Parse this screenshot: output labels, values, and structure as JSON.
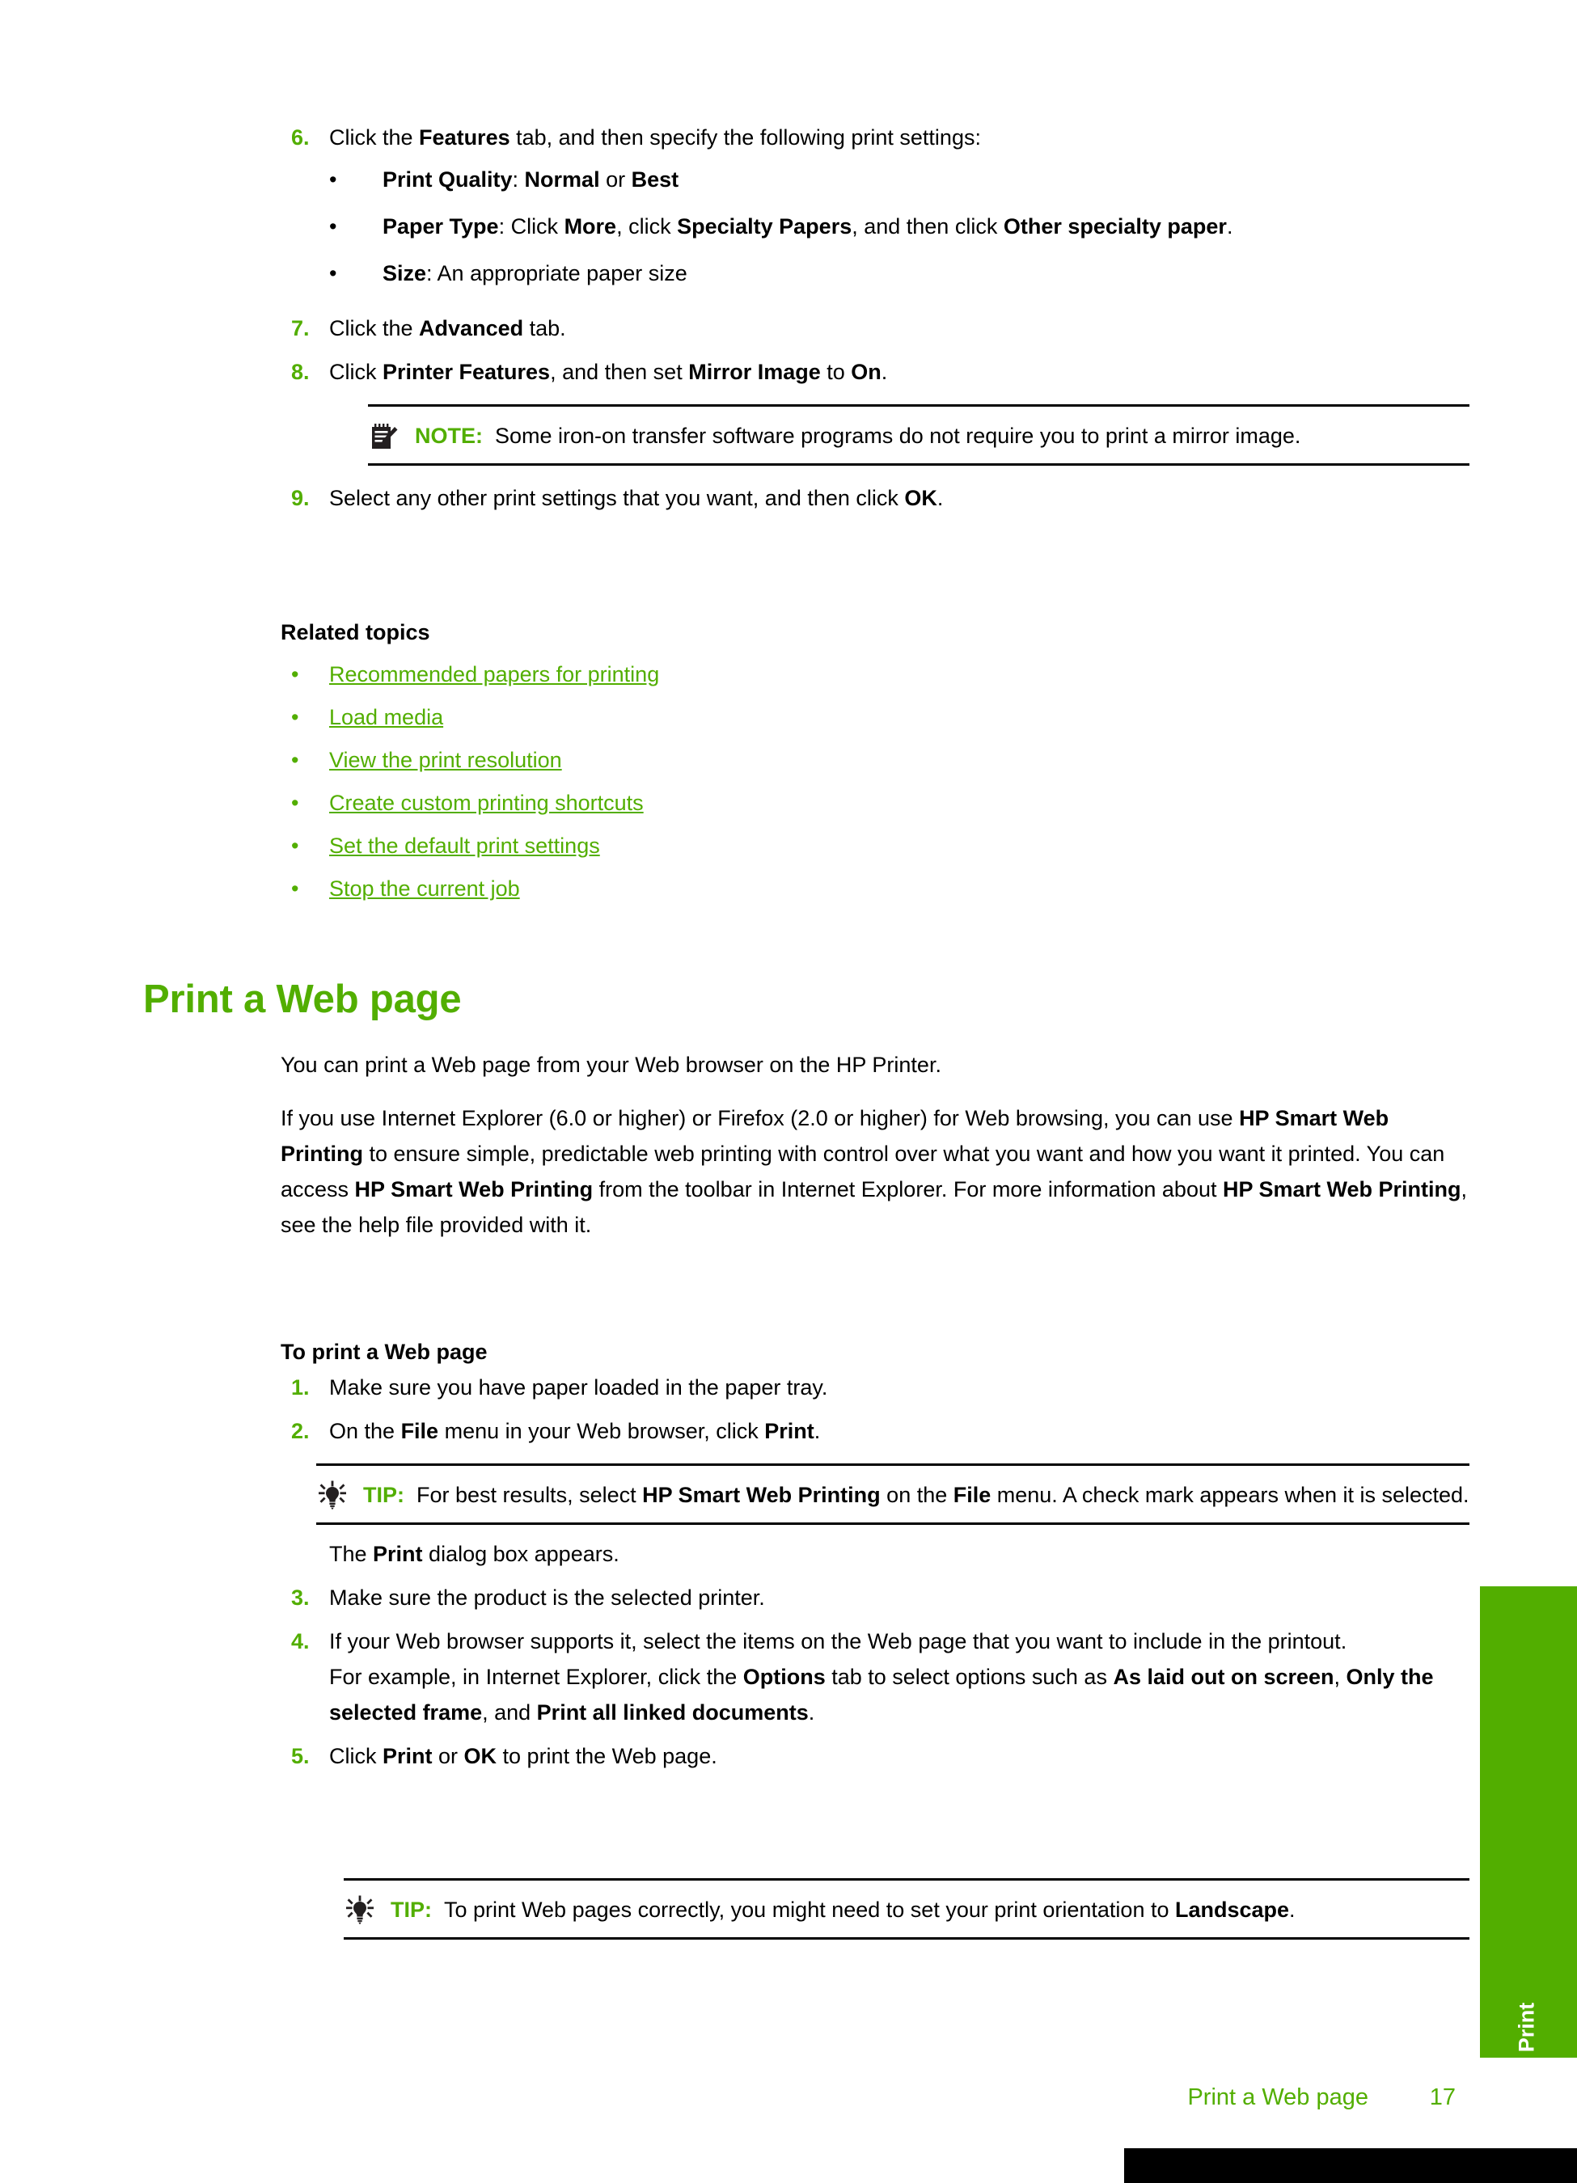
{
  "colors": {
    "accent_green": "#52ae00",
    "text_black": "#000000",
    "page_white": "#ffffff"
  },
  "steps_group_1": [
    {
      "num": "6.",
      "text_parts": [
        {
          "t": "Click the ",
          "b": false
        },
        {
          "t": "Features",
          "b": true
        },
        {
          "t": " tab, and then specify the following print settings:",
          "b": false
        }
      ],
      "subbullets": [
        {
          "bullet": "•",
          "parts": [
            {
              "t": "Print Quality",
              "b": true
            },
            {
              "t": ": ",
              "b": false
            },
            {
              "t": "Normal",
              "b": true
            },
            {
              "t": " or ",
              "b": false
            },
            {
              "t": "Best",
              "b": true
            }
          ]
        },
        {
          "bullet": "•",
          "parts": [
            {
              "t": "Paper Type",
              "b": true
            },
            {
              "t": ": Click ",
              "b": false
            },
            {
              "t": "More",
              "b": true
            },
            {
              "t": ", click ",
              "b": false
            },
            {
              "t": "Specialty Papers",
              "b": true
            },
            {
              "t": ", and then click ",
              "b": false
            },
            {
              "t": "Other specialty paper",
              "b": true
            },
            {
              "t": ".",
              "b": false
            }
          ]
        },
        {
          "bullet": "•",
          "parts": [
            {
              "t": "Size",
              "b": true
            },
            {
              "t": ": An appropriate paper size",
              "b": false
            }
          ]
        }
      ]
    },
    {
      "num": "7.",
      "text_parts": [
        {
          "t": "Click the ",
          "b": false
        },
        {
          "t": "Advanced",
          "b": true
        },
        {
          "t": " tab.",
          "b": false
        }
      ]
    },
    {
      "num": "8.",
      "text_parts": [
        {
          "t": "Click ",
          "b": false
        },
        {
          "t": "Printer Features",
          "b": true
        },
        {
          "t": ", and then set ",
          "b": false
        },
        {
          "t": "Mirror Image",
          "b": true
        },
        {
          "t": " to ",
          "b": false
        },
        {
          "t": "On",
          "b": true
        },
        {
          "t": ".",
          "b": false
        }
      ]
    },
    {
      "num": "9.",
      "text_parts": [
        {
          "t": "Select any other print settings that you want, and then click ",
          "b": false
        },
        {
          "t": "OK",
          "b": true
        },
        {
          "t": ".",
          "b": false
        }
      ]
    }
  ],
  "note_1": {
    "icon": "note-pencil-icon",
    "label": "NOTE:",
    "parts": [
      {
        "t": "  Some iron-on transfer software programs do not require you to print a mirror image.",
        "b": false
      }
    ]
  },
  "related": {
    "heading": "Related topics",
    "bullet": "•",
    "links": [
      "Recommended papers for printing",
      "Load media",
      "View the print resolution",
      "Create custom printing shortcuts",
      "Set the default print settings",
      "Stop the current job"
    ]
  },
  "h1": "Print a Web page",
  "intro": {
    "para1_parts": [
      {
        "t": "You can print a Web page from your Web browser on the HP Printer.",
        "b": false
      }
    ],
    "para2_parts": [
      {
        "t": "If you use Internet Explorer (6.0 or higher) or Firefox (2.0 or higher) for Web browsing, you can use ",
        "b": false
      },
      {
        "t": "HP Smart Web Printing",
        "b": true
      },
      {
        "t": " to ensure simple, predictable web printing with control over what you want and how you want it printed. You can access ",
        "b": false
      },
      {
        "t": "HP Smart Web Printing",
        "b": true
      },
      {
        "t": " from the toolbar in Internet Explorer. For more information about ",
        "b": false
      },
      {
        "t": "HP Smart Web Printing",
        "b": true
      },
      {
        "t": ", see the help file provided with it.",
        "b": false
      }
    ]
  },
  "howto": {
    "heading": "To print a Web page",
    "steps_a": [
      {
        "num": "1.",
        "text_parts": [
          {
            "t": "Make sure you have paper loaded in the paper tray.",
            "b": false
          }
        ]
      },
      {
        "num": "2.",
        "text_parts": [
          {
            "t": "On the ",
            "b": false
          },
          {
            "t": "File",
            "b": true
          },
          {
            "t": " menu in your Web browser, click ",
            "b": false
          },
          {
            "t": "Print",
            "b": true
          },
          {
            "t": ".",
            "b": false
          }
        ]
      }
    ],
    "tip_inline": {
      "icon": "lightbulb-icon",
      "label": "TIP:",
      "parts": [
        {
          "t": "  For best results, select ",
          "b": false
        },
        {
          "t": "HP Smart Web Printing",
          "b": true
        },
        {
          "t": " on the ",
          "b": false
        },
        {
          "t": "File",
          "b": true
        },
        {
          "t": " menu. A check mark appears when it is selected.",
          "b": false
        }
      ]
    },
    "after_tip_parts": [
      {
        "t": "The ",
        "b": false
      },
      {
        "t": "Print",
        "b": true
      },
      {
        "t": " dialog box appears.",
        "b": false
      }
    ],
    "steps_b": [
      {
        "num": "3.",
        "text_parts": [
          {
            "t": "Make sure the product is the selected printer.",
            "b": false
          }
        ]
      },
      {
        "num": "4.",
        "text_parts": [
          {
            "t": "If your Web browser supports it, select the items on the Web page that you want to include in the printout.",
            "b": false
          }
        ],
        "continuation_parts": [
          {
            "t": "For example, in Internet Explorer, click the ",
            "b": false
          },
          {
            "t": "Options",
            "b": true
          },
          {
            "t": " tab to select options such as ",
            "b": false
          },
          {
            "t": "As laid out on screen",
            "b": true
          },
          {
            "t": ", ",
            "b": false
          },
          {
            "t": "Only the selected frame",
            "b": true
          },
          {
            "t": ", and ",
            "b": false
          },
          {
            "t": "Print all linked documents",
            "b": true
          },
          {
            "t": ".",
            "b": false
          }
        ]
      },
      {
        "num": "5.",
        "text_parts": [
          {
            "t": "Click ",
            "b": false
          },
          {
            "t": "Print",
            "b": true
          },
          {
            "t": " or ",
            "b": false
          },
          {
            "t": "OK",
            "b": true
          },
          {
            "t": " to print the Web page.",
            "b": false
          }
        ]
      }
    ]
  },
  "tip_final": {
    "icon": "lightbulb-icon",
    "label": "TIP:",
    "parts": [
      {
        "t": "  To print Web pages correctly, you might need to set your print orientation to ",
        "b": false
      },
      {
        "t": "Landscape",
        "b": true
      },
      {
        "t": ".",
        "b": false
      }
    ]
  },
  "side_tab": {
    "label": "Print"
  },
  "footer": {
    "title": "Print a Web page",
    "page_number": "17"
  }
}
